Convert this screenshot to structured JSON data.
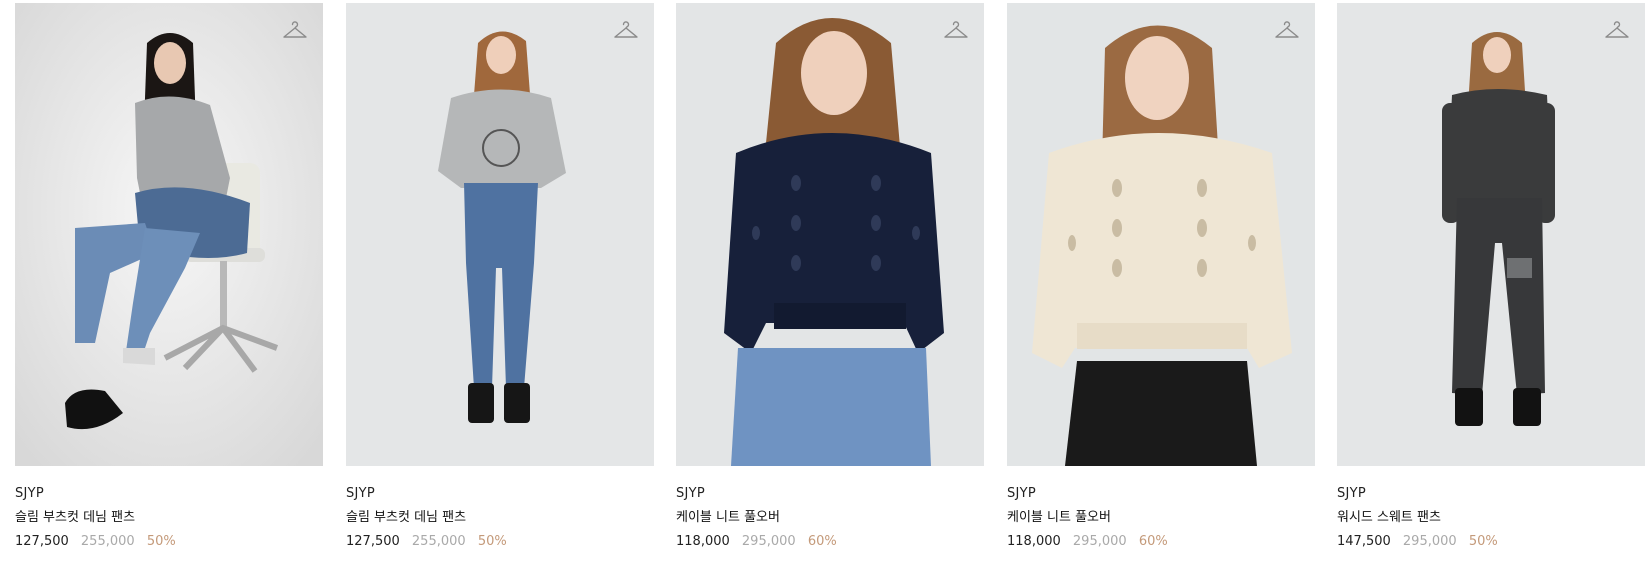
{
  "products": [
    {
      "brand": "SJYP",
      "name": "슬림 부츠컷 데님 팬츠",
      "price": "127,500",
      "original_price": "255,000",
      "discount": "50%",
      "wishlist_icon": "hanger-icon"
    },
    {
      "brand": "SJYP",
      "name": "슬림 부츠컷 데님 팬츠",
      "price": "127,500",
      "original_price": "255,000",
      "discount": "50%",
      "wishlist_icon": "hanger-icon"
    },
    {
      "brand": "SJYP",
      "name": "케이블 니트 풀오버",
      "price": "118,000",
      "original_price": "295,000",
      "discount": "60%",
      "wishlist_icon": "hanger-icon"
    },
    {
      "brand": "SJYP",
      "name": "케이블 니트 풀오버",
      "price": "118,000",
      "original_price": "295,000",
      "discount": "60%",
      "wishlist_icon": "hanger-icon"
    },
    {
      "brand": "SJYP",
      "name": "워시드 스웨트 팬츠",
      "price": "147,500",
      "original_price": "295,000",
      "discount": "50%",
      "wishlist_icon": "hanger-icon"
    }
  ],
  "colors": {
    "discount": "#c49a7a",
    "original_price": "#a9a9a9",
    "photo_background": "#e4e6e7",
    "navy_knit": "#17203a",
    "ivory_knit": "#efe6d4",
    "charcoal": "#3a3b3c",
    "denim": "#5f7ea8"
  }
}
